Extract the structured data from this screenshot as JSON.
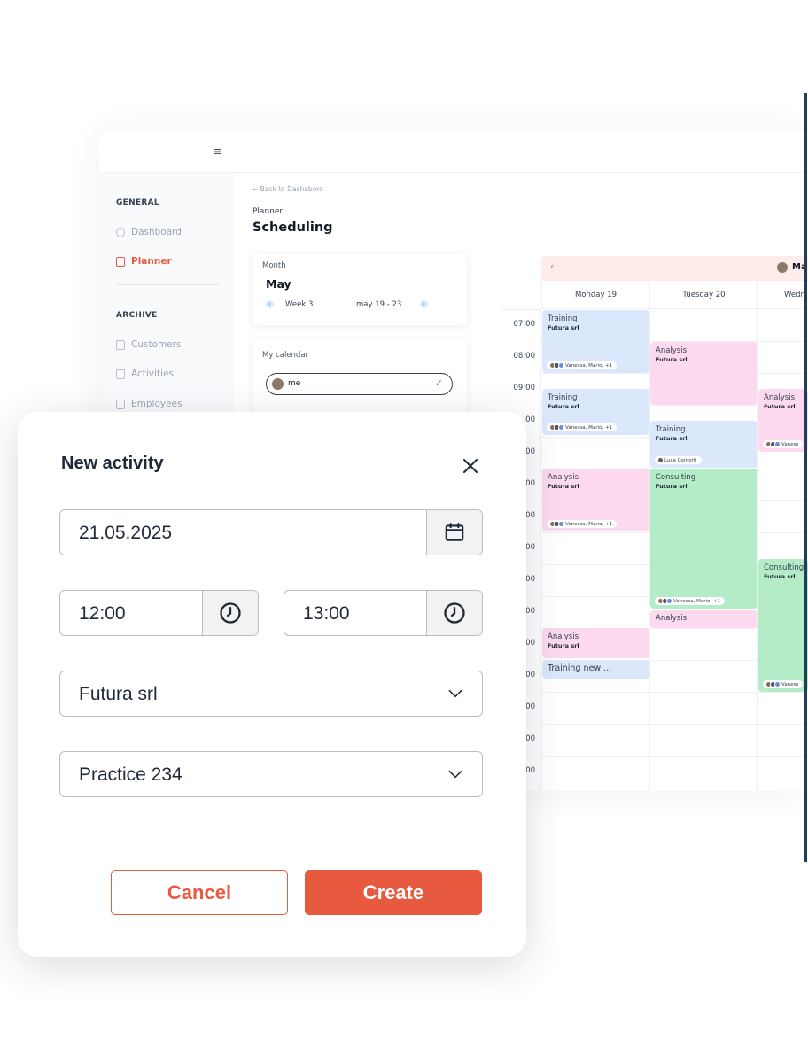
{
  "topbar": {
    "menu_glyph": "≡"
  },
  "sidebar": {
    "general_heading": "GENERAL",
    "archive_heading": "ARCHIVE",
    "items": [
      {
        "label": "Dashboard",
        "icon": "dashboard-icon"
      },
      {
        "label": "Planner",
        "icon": "calendar-icon",
        "active": true
      },
      {
        "label": "Customers",
        "icon": "customers-icon"
      },
      {
        "label": "Activities",
        "icon": "clipboard-icon"
      },
      {
        "label": "Employees",
        "icon": "employees-icon"
      }
    ]
  },
  "header": {
    "back_link": "Back to Dashabord",
    "breadcrumb": "Planner",
    "title": "Scheduling"
  },
  "month_card": {
    "label": "Month",
    "month": "May",
    "week": "Week 3",
    "range": "may 19 - 23"
  },
  "calendar_card": {
    "label": "My calendar",
    "selected": "me"
  },
  "scheduler": {
    "user_initial": "Ma",
    "days": [
      "Monday 19",
      "Tuesday 20",
      "Wedn"
    ],
    "times": [
      "07:00",
      "08:00",
      "09:00",
      "10:00",
      "11:00",
      "12:00",
      "13:00",
      "14:00",
      "15:00",
      "16:00",
      "17:00",
      "18:00",
      "19:00",
      "20:00",
      "21:00"
    ],
    "time_labels_visible": [
      "07:00",
      "08:00",
      "09:00",
      "00",
      "00",
      "00",
      "00",
      "00",
      "00",
      "00",
      "00",
      "00",
      "00",
      "00",
      "00"
    ],
    "events": [
      {
        "title": "Training",
        "client": "Futura srl",
        "attendees": "Vanessa, Mario, +1",
        "color": "blue"
      },
      {
        "title": "Training",
        "client": "Futura srl",
        "attendees": "Vanessa, Mario, +1",
        "color": "blue"
      },
      {
        "title": "Analysis",
        "client": "Futura srl",
        "attendees": "Vanessa, Mario, +1",
        "color": "pink"
      },
      {
        "title": "Analysis",
        "client": "Futura srl",
        "color": "pink"
      },
      {
        "title": "Training new ...",
        "color": "blue"
      },
      {
        "title": "Analysis",
        "client": "Futura srl",
        "color": "pink"
      },
      {
        "title": "Training",
        "client": "Futura srl",
        "attendees": "Luca Conforti",
        "color": "blue"
      },
      {
        "title": "Consulting",
        "client": "Futura srl",
        "attendees": "Vanessa, Mario, +1",
        "color": "green"
      },
      {
        "title": "Analysis",
        "color": "pink"
      },
      {
        "title": "Analysis",
        "client": "Futura srl",
        "attendees": "Vaness",
        "color": "pink"
      },
      {
        "title": "Consulting",
        "client": "Futura srl",
        "attendees": "Vaness",
        "color": "green"
      }
    ]
  },
  "modal": {
    "title": "New activity",
    "date": "21.05.2025",
    "start_time": "12:00",
    "end_time": "13:00",
    "client": "Futura srl",
    "practice": "Practice 234",
    "cancel_label": "Cancel",
    "create_label": "Create"
  },
  "colors": {
    "accent": "#e85a3f",
    "event_blue": "#dbe8fb",
    "event_pink": "#fcd9ee",
    "event_green": "#b4ecc7"
  }
}
